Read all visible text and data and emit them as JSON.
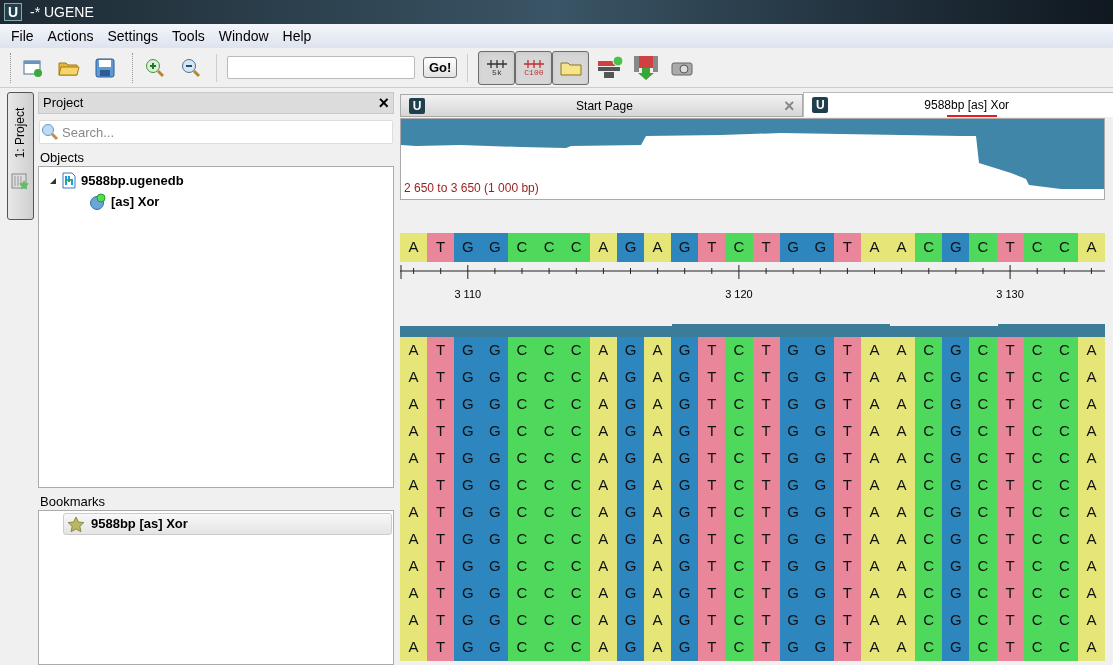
{
  "window": {
    "logo": "U",
    "title": "-* UGENE"
  },
  "menu": [
    "File",
    "Actions",
    "Settings",
    "Tools",
    "Window",
    "Help"
  ],
  "toolbar": {
    "go_button": "Go!",
    "toggles": [
      {
        "kind": "ruler",
        "label": "5k",
        "checked": true
      },
      {
        "kind": "ruler-red",
        "label": "C100",
        "checked": true
      },
      {
        "kind": "folder",
        "checked": true
      }
    ]
  },
  "side_tab": {
    "label": "1: Project"
  },
  "project_panel": {
    "title": "Project",
    "close": "×",
    "search": {
      "placeholder": "Search..."
    },
    "objects_label": "Objects",
    "tree": [
      {
        "label": "9588bp.ugenedb",
        "kind": "database",
        "expanded": true,
        "children": [
          {
            "label": "[as] Xor",
            "kind": "alignment"
          }
        ]
      }
    ],
    "bookmarks_label": "Bookmarks",
    "bookmarks": [
      {
        "label": "9588bp [as] Xor"
      }
    ]
  },
  "tabs": [
    {
      "logo": "U",
      "label": "Start Page",
      "close": "×",
      "selected": false
    },
    {
      "logo": "U",
      "label": "9588bp [as] Xor",
      "selected": true
    }
  ],
  "overview": {
    "range": "2 650 to 3 650 (1 000 bp)"
  },
  "reference": [
    {
      "base": "A",
      "color": "#e6e678"
    },
    {
      "base": "T",
      "color": "#e9869a"
    },
    {
      "base": "G",
      "color": "#2e86bf"
    },
    {
      "base": "G",
      "color": "#2e86bf"
    },
    {
      "base": "C",
      "color": "#4ed85c"
    },
    {
      "base": "C",
      "color": "#4ed85c"
    },
    {
      "base": "C",
      "color": "#4ed85c"
    },
    {
      "base": "A",
      "color": "#e6e678"
    },
    {
      "base": "G",
      "color": "#2e86bf"
    },
    {
      "base": "A",
      "color": "#e6e678"
    },
    {
      "base": "G",
      "color": "#2e86bf"
    },
    {
      "base": "T",
      "color": "#e9869a"
    },
    {
      "base": "C",
      "color": "#4ed85c"
    },
    {
      "base": "T",
      "color": "#e9869a"
    },
    {
      "base": "G",
      "color": "#2e86bf"
    },
    {
      "base": "G",
      "color": "#2e86bf"
    },
    {
      "base": "T",
      "color": "#e9869a"
    },
    {
      "base": "A",
      "color": "#e6e678"
    },
    {
      "base": "A",
      "color": "#e6e678"
    },
    {
      "base": "C",
      "color": "#4ed85c"
    },
    {
      "base": "G",
      "color": "#2e86bf"
    },
    {
      "base": "C",
      "color": "#4ed85c"
    },
    {
      "base": "T",
      "color": "#e9869a"
    },
    {
      "base": "C",
      "color": "#4ed85c"
    },
    {
      "base": "C",
      "color": "#4ed85c"
    },
    {
      "base": "A",
      "color": "#e6e678"
    }
  ],
  "ruler": {
    "labels": [
      "3 110",
      "3 120",
      "3 130"
    ]
  },
  "reads": [
    {
      "bases": [
        {
          "base": "A",
          "color": "#e6e678"
        },
        {
          "base": "T",
          "color": "#e9869a"
        },
        {
          "base": "G",
          "color": "#2e86bf"
        },
        {
          "base": "G",
          "color": "#2e86bf"
        },
        {
          "base": "C",
          "color": "#4ed85c"
        },
        {
          "base": "C",
          "color": "#4ed85c"
        },
        {
          "base": "C",
          "color": "#4ed85c"
        },
        {
          "base": "A",
          "color": "#e6e678"
        },
        {
          "base": "G",
          "color": "#2e86bf"
        },
        {
          "base": "A",
          "color": "#e6e678"
        },
        {
          "base": "G",
          "color": "#2e86bf"
        },
        {
          "base": "T",
          "color": "#e9869a"
        },
        {
          "base": "C",
          "color": "#4ed85c"
        },
        {
          "base": "T",
          "color": "#e9869a"
        },
        {
          "base": "G",
          "color": "#2e86bf"
        },
        {
          "base": "G",
          "color": "#2e86bf"
        },
        {
          "base": "T",
          "color": "#e9869a"
        },
        {
          "base": "A",
          "color": "#e6e678"
        },
        {
          "base": "A",
          "color": "#e6e678"
        },
        {
          "base": "C",
          "color": "#4ed85c"
        },
        {
          "base": "G",
          "color": "#2e86bf"
        },
        {
          "base": "C",
          "color": "#4ed85c"
        },
        {
          "base": "T",
          "color": "#e9869a"
        },
        {
          "base": "C",
          "color": "#4ed85c"
        },
        {
          "base": "C",
          "color": "#4ed85c"
        },
        {
          "base": "A",
          "color": "#e6e678"
        }
      ]
    },
    {
      "bases": [
        {
          "base": "A",
          "color": "#e6e678"
        },
        {
          "base": "T",
          "color": "#e9869a"
        },
        {
          "base": "G",
          "color": "#2e86bf"
        },
        {
          "base": "G",
          "color": "#2e86bf"
        },
        {
          "base": "C",
          "color": "#4ed85c"
        },
        {
          "base": "C",
          "color": "#4ed85c"
        },
        {
          "base": "C",
          "color": "#4ed85c"
        },
        {
          "base": "A",
          "color": "#e6e678"
        },
        {
          "base": "G",
          "color": "#2e86bf"
        },
        {
          "base": "A",
          "color": "#e6e678"
        },
        {
          "base": "G",
          "color": "#2e86bf"
        },
        {
          "base": "T",
          "color": "#e9869a"
        },
        {
          "base": "C",
          "color": "#4ed85c"
        },
        {
          "base": "T",
          "color": "#e9869a"
        },
        {
          "base": "G",
          "color": "#2e86bf"
        },
        {
          "base": "G",
          "color": "#2e86bf"
        },
        {
          "base": "T",
          "color": "#e9869a"
        },
        {
          "base": "A",
          "color": "#e6e678"
        },
        {
          "base": "A",
          "color": "#e6e678"
        },
        {
          "base": "C",
          "color": "#4ed85c"
        },
        {
          "base": "G",
          "color": "#2e86bf"
        },
        {
          "base": "C",
          "color": "#4ed85c"
        },
        {
          "base": "T",
          "color": "#e9869a"
        },
        {
          "base": "C",
          "color": "#4ed85c"
        },
        {
          "base": "C",
          "color": "#4ed85c"
        },
        {
          "base": "A",
          "color": "#e6e678"
        }
      ]
    },
    {
      "bases": [
        {
          "base": "A",
          "color": "#e6e678"
        },
        {
          "base": "T",
          "color": "#e9869a"
        },
        {
          "base": "G",
          "color": "#2e86bf"
        },
        {
          "base": "G",
          "color": "#2e86bf"
        },
        {
          "base": "C",
          "color": "#4ed85c"
        },
        {
          "base": "C",
          "color": "#4ed85c"
        },
        {
          "base": "C",
          "color": "#4ed85c"
        },
        {
          "base": "A",
          "color": "#e6e678"
        },
        {
          "base": "G",
          "color": "#2e86bf"
        },
        {
          "base": "A",
          "color": "#e6e678"
        },
        {
          "base": "G",
          "color": "#2e86bf"
        },
        {
          "base": "T",
          "color": "#e9869a"
        },
        {
          "base": "C",
          "color": "#4ed85c"
        },
        {
          "base": "T",
          "color": "#e9869a"
        },
        {
          "base": "G",
          "color": "#2e86bf"
        },
        {
          "base": "G",
          "color": "#2e86bf"
        },
        {
          "base": "T",
          "color": "#e9869a"
        },
        {
          "base": "A",
          "color": "#e6e678"
        },
        {
          "base": "A",
          "color": "#e6e678"
        },
        {
          "base": "C",
          "color": "#4ed85c"
        },
        {
          "base": "G",
          "color": "#2e86bf"
        },
        {
          "base": "C",
          "color": "#4ed85c"
        },
        {
          "base": "T",
          "color": "#e9869a"
        },
        {
          "base": "C",
          "color": "#4ed85c"
        },
        {
          "base": "C",
          "color": "#4ed85c"
        },
        {
          "base": "A",
          "color": "#e6e678"
        }
      ]
    },
    {
      "bases": [
        {
          "base": "A",
          "color": "#e6e678"
        },
        {
          "base": "T",
          "color": "#e9869a"
        },
        {
          "base": "G",
          "color": "#2e86bf"
        },
        {
          "base": "G",
          "color": "#2e86bf"
        },
        {
          "base": "C",
          "color": "#4ed85c"
        },
        {
          "base": "C",
          "color": "#4ed85c"
        },
        {
          "base": "C",
          "color": "#4ed85c"
        },
        {
          "base": "A",
          "color": "#e6e678"
        },
        {
          "base": "G",
          "color": "#2e86bf"
        },
        {
          "base": "A",
          "color": "#e6e678"
        },
        {
          "base": "G",
          "color": "#2e86bf"
        },
        {
          "base": "T",
          "color": "#e9869a"
        },
        {
          "base": "C",
          "color": "#4ed85c"
        },
        {
          "base": "T",
          "color": "#e9869a"
        },
        {
          "base": "G",
          "color": "#2e86bf"
        },
        {
          "base": "G",
          "color": "#2e86bf"
        },
        {
          "base": "T",
          "color": "#e9869a"
        },
        {
          "base": "A",
          "color": "#e6e678"
        },
        {
          "base": "A",
          "color": "#e6e678"
        },
        {
          "base": "C",
          "color": "#4ed85c"
        },
        {
          "base": "G",
          "color": "#2e86bf"
        },
        {
          "base": "C",
          "color": "#4ed85c"
        },
        {
          "base": "T",
          "color": "#e9869a"
        },
        {
          "base": "C",
          "color": "#4ed85c"
        },
        {
          "base": "C",
          "color": "#4ed85c"
        },
        {
          "base": "A",
          "color": "#e6e678"
        }
      ]
    },
    {
      "bases": [
        {
          "base": "A",
          "color": "#e6e678"
        },
        {
          "base": "T",
          "color": "#e9869a"
        },
        {
          "base": "G",
          "color": "#2e86bf"
        },
        {
          "base": "G",
          "color": "#2e86bf"
        },
        {
          "base": "C",
          "color": "#4ed85c"
        },
        {
          "base": "C",
          "color": "#4ed85c"
        },
        {
          "base": "C",
          "color": "#4ed85c"
        },
        {
          "base": "A",
          "color": "#e6e678"
        },
        {
          "base": "G",
          "color": "#2e86bf"
        },
        {
          "base": "A",
          "color": "#e6e678"
        },
        {
          "base": "G",
          "color": "#2e86bf"
        },
        {
          "base": "T",
          "color": "#e9869a"
        },
        {
          "base": "C",
          "color": "#4ed85c"
        },
        {
          "base": "T",
          "color": "#e9869a"
        },
        {
          "base": "G",
          "color": "#2e86bf"
        },
        {
          "base": "G",
          "color": "#2e86bf"
        },
        {
          "base": "T",
          "color": "#e9869a"
        },
        {
          "base": "A",
          "color": "#e6e678"
        },
        {
          "base": "A",
          "color": "#e6e678"
        },
        {
          "base": "C",
          "color": "#4ed85c"
        },
        {
          "base": "G",
          "color": "#2e86bf"
        },
        {
          "base": "C",
          "color": "#4ed85c"
        },
        {
          "base": "T",
          "color": "#e9869a"
        },
        {
          "base": "C",
          "color": "#4ed85c"
        },
        {
          "base": "C",
          "color": "#4ed85c"
        },
        {
          "base": "A",
          "color": "#e6e678"
        }
      ]
    },
    {
      "bases": [
        {
          "base": "A",
          "color": "#e6e678"
        },
        {
          "base": "T",
          "color": "#e9869a"
        },
        {
          "base": "G",
          "color": "#2e86bf"
        },
        {
          "base": "G",
          "color": "#2e86bf"
        },
        {
          "base": "C",
          "color": "#4ed85c"
        },
        {
          "base": "C",
          "color": "#4ed85c"
        },
        {
          "base": "C",
          "color": "#4ed85c"
        },
        {
          "base": "A",
          "color": "#e6e678"
        },
        {
          "base": "G",
          "color": "#2e86bf"
        },
        {
          "base": "A",
          "color": "#e6e678"
        },
        {
          "base": "G",
          "color": "#2e86bf"
        },
        {
          "base": "T",
          "color": "#e9869a"
        },
        {
          "base": "C",
          "color": "#4ed85c"
        },
        {
          "base": "T",
          "color": "#e9869a"
        },
        {
          "base": "G",
          "color": "#2e86bf"
        },
        {
          "base": "G",
          "color": "#2e86bf"
        },
        {
          "base": "T",
          "color": "#e9869a"
        },
        {
          "base": "A",
          "color": "#e6e678"
        },
        {
          "base": "A",
          "color": "#e6e678"
        },
        {
          "base": "C",
          "color": "#4ed85c"
        },
        {
          "base": "G",
          "color": "#2e86bf"
        },
        {
          "base": "C",
          "color": "#4ed85c"
        },
        {
          "base": "T",
          "color": "#e9869a"
        },
        {
          "base": "C",
          "color": "#4ed85c"
        },
        {
          "base": "C",
          "color": "#4ed85c"
        },
        {
          "base": "A",
          "color": "#e6e678"
        }
      ]
    },
    {
      "bases": [
        {
          "base": "A",
          "color": "#e6e678"
        },
        {
          "base": "T",
          "color": "#e9869a"
        },
        {
          "base": "G",
          "color": "#2e86bf"
        },
        {
          "base": "G",
          "color": "#2e86bf"
        },
        {
          "base": "C",
          "color": "#4ed85c"
        },
        {
          "base": "C",
          "color": "#4ed85c"
        },
        {
          "base": "C",
          "color": "#4ed85c"
        },
        {
          "base": "A",
          "color": "#e6e678"
        },
        {
          "base": "G",
          "color": "#2e86bf"
        },
        {
          "base": "A",
          "color": "#e6e678"
        },
        {
          "base": "G",
          "color": "#2e86bf"
        },
        {
          "base": "T",
          "color": "#e9869a"
        },
        {
          "base": "C",
          "color": "#4ed85c"
        },
        {
          "base": "T",
          "color": "#e9869a"
        },
        {
          "base": "G",
          "color": "#2e86bf"
        },
        {
          "base": "G",
          "color": "#2e86bf"
        },
        {
          "base": "T",
          "color": "#e9869a"
        },
        {
          "base": "A",
          "color": "#e6e678"
        },
        {
          "base": "A",
          "color": "#e6e678"
        },
        {
          "base": "C",
          "color": "#4ed85c"
        },
        {
          "base": "G",
          "color": "#2e86bf"
        },
        {
          "base": "C",
          "color": "#4ed85c"
        },
        {
          "base": "T",
          "color": "#e9869a"
        },
        {
          "base": "C",
          "color": "#4ed85c"
        },
        {
          "base": "C",
          "color": "#4ed85c"
        },
        {
          "base": "A",
          "color": "#e6e678"
        }
      ]
    },
    {
      "bases": [
        {
          "base": "A",
          "color": "#e6e678"
        },
        {
          "base": "T",
          "color": "#e9869a"
        },
        {
          "base": "G",
          "color": "#2e86bf"
        },
        {
          "base": "G",
          "color": "#2e86bf"
        },
        {
          "base": "C",
          "color": "#4ed85c"
        },
        {
          "base": "C",
          "color": "#4ed85c"
        },
        {
          "base": "C",
          "color": "#4ed85c"
        },
        {
          "base": "A",
          "color": "#e6e678"
        },
        {
          "base": "G",
          "color": "#2e86bf"
        },
        {
          "base": "A",
          "color": "#e6e678"
        },
        {
          "base": "G",
          "color": "#2e86bf"
        },
        {
          "base": "T",
          "color": "#e9869a"
        },
        {
          "base": "C",
          "color": "#4ed85c"
        },
        {
          "base": "T",
          "color": "#e9869a"
        },
        {
          "base": "G",
          "color": "#2e86bf"
        },
        {
          "base": "G",
          "color": "#2e86bf"
        },
        {
          "base": "T",
          "color": "#e9869a"
        },
        {
          "base": "A",
          "color": "#e6e678"
        },
        {
          "base": "A",
          "color": "#e6e678"
        },
        {
          "base": "C",
          "color": "#4ed85c"
        },
        {
          "base": "G",
          "color": "#2e86bf"
        },
        {
          "base": "C",
          "color": "#4ed85c"
        },
        {
          "base": "T",
          "color": "#e9869a"
        },
        {
          "base": "C",
          "color": "#4ed85c"
        },
        {
          "base": "C",
          "color": "#4ed85c"
        },
        {
          "base": "A",
          "color": "#e6e678"
        }
      ]
    },
    {
      "bases": [
        {
          "base": "A",
          "color": "#e6e678"
        },
        {
          "base": "T",
          "color": "#e9869a"
        },
        {
          "base": "G",
          "color": "#2e86bf"
        },
        {
          "base": "G",
          "color": "#2e86bf"
        },
        {
          "base": "C",
          "color": "#4ed85c"
        },
        {
          "base": "C",
          "color": "#4ed85c"
        },
        {
          "base": "C",
          "color": "#4ed85c"
        },
        {
          "base": "A",
          "color": "#e6e678"
        },
        {
          "base": "G",
          "color": "#2e86bf"
        },
        {
          "base": "A",
          "color": "#e6e678"
        },
        {
          "base": "G",
          "color": "#2e86bf"
        },
        {
          "base": "T",
          "color": "#e9869a"
        },
        {
          "base": "C",
          "color": "#4ed85c"
        },
        {
          "base": "T",
          "color": "#e9869a"
        },
        {
          "base": "G",
          "color": "#2e86bf"
        },
        {
          "base": "G",
          "color": "#2e86bf"
        },
        {
          "base": "T",
          "color": "#e9869a"
        },
        {
          "base": "A",
          "color": "#e6e678"
        },
        {
          "base": "A",
          "color": "#e6e678"
        },
        {
          "base": "C",
          "color": "#4ed85c"
        },
        {
          "base": "G",
          "color": "#2e86bf"
        },
        {
          "base": "C",
          "color": "#4ed85c"
        },
        {
          "base": "T",
          "color": "#e9869a"
        },
        {
          "base": "C",
          "color": "#4ed85c"
        },
        {
          "base": "C",
          "color": "#4ed85c"
        },
        {
          "base": "A",
          "color": "#e6e678"
        }
      ]
    },
    {
      "bases": [
        {
          "base": "A",
          "color": "#e6e678"
        },
        {
          "base": "T",
          "color": "#e9869a"
        },
        {
          "base": "G",
          "color": "#2e86bf"
        },
        {
          "base": "G",
          "color": "#2e86bf"
        },
        {
          "base": "C",
          "color": "#4ed85c"
        },
        {
          "base": "C",
          "color": "#4ed85c"
        },
        {
          "base": "C",
          "color": "#4ed85c"
        },
        {
          "base": "A",
          "color": "#e6e678"
        },
        {
          "base": "G",
          "color": "#2e86bf"
        },
        {
          "base": "A",
          "color": "#e6e678"
        },
        {
          "base": "G",
          "color": "#2e86bf"
        },
        {
          "base": "T",
          "color": "#e9869a"
        },
        {
          "base": "C",
          "color": "#4ed85c"
        },
        {
          "base": "T",
          "color": "#e9869a"
        },
        {
          "base": "G",
          "color": "#2e86bf"
        },
        {
          "base": "G",
          "color": "#2e86bf"
        },
        {
          "base": "T",
          "color": "#e9869a"
        },
        {
          "base": "A",
          "color": "#e6e678"
        },
        {
          "base": "A",
          "color": "#e6e678"
        },
        {
          "base": "C",
          "color": "#4ed85c"
        },
        {
          "base": "G",
          "color": "#2e86bf"
        },
        {
          "base": "C",
          "color": "#4ed85c"
        },
        {
          "base": "T",
          "color": "#e9869a"
        },
        {
          "base": "C",
          "color": "#4ed85c"
        },
        {
          "base": "C",
          "color": "#4ed85c"
        },
        {
          "base": "A",
          "color": "#e6e678"
        }
      ]
    },
    {
      "bases": [
        {
          "base": "A",
          "color": "#e6e678"
        },
        {
          "base": "T",
          "color": "#e9869a"
        },
        {
          "base": "G",
          "color": "#2e86bf"
        },
        {
          "base": "G",
          "color": "#2e86bf"
        },
        {
          "base": "C",
          "color": "#4ed85c"
        },
        {
          "base": "C",
          "color": "#4ed85c"
        },
        {
          "base": "C",
          "color": "#4ed85c"
        },
        {
          "base": "A",
          "color": "#e6e678"
        },
        {
          "base": "G",
          "color": "#2e86bf"
        },
        {
          "base": "A",
          "color": "#e6e678"
        },
        {
          "base": "G",
          "color": "#2e86bf"
        },
        {
          "base": "T",
          "color": "#e9869a"
        },
        {
          "base": "C",
          "color": "#4ed85c"
        },
        {
          "base": "T",
          "color": "#e9869a"
        },
        {
          "base": "G",
          "color": "#2e86bf"
        },
        {
          "base": "G",
          "color": "#2e86bf"
        },
        {
          "base": "T",
          "color": "#e9869a"
        },
        {
          "base": "A",
          "color": "#e6e678"
        },
        {
          "base": "A",
          "color": "#e6e678"
        },
        {
          "base": "C",
          "color": "#4ed85c"
        },
        {
          "base": "G",
          "color": "#2e86bf"
        },
        {
          "base": "C",
          "color": "#4ed85c"
        },
        {
          "base": "T",
          "color": "#e9869a"
        },
        {
          "base": "C",
          "color": "#4ed85c"
        },
        {
          "base": "C",
          "color": "#4ed85c"
        },
        {
          "base": "A",
          "color": "#e6e678"
        }
      ]
    },
    {
      "bases": [
        {
          "base": "A",
          "color": "#e6e678"
        },
        {
          "base": "T",
          "color": "#e9869a"
        },
        {
          "base": "G",
          "color": "#2e86bf"
        },
        {
          "base": "G",
          "color": "#2e86bf"
        },
        {
          "base": "C",
          "color": "#4ed85c"
        },
        {
          "base": "C",
          "color": "#4ed85c"
        },
        {
          "base": "C",
          "color": "#4ed85c"
        },
        {
          "base": "A",
          "color": "#e6e678"
        },
        {
          "base": "G",
          "color": "#2e86bf"
        },
        {
          "base": "A",
          "color": "#e6e678"
        },
        {
          "base": "G",
          "color": "#2e86bf"
        },
        {
          "base": "T",
          "color": "#e9869a"
        },
        {
          "base": "C",
          "color": "#4ed85c"
        },
        {
          "base": "T",
          "color": "#e9869a"
        },
        {
          "base": "G",
          "color": "#2e86bf"
        },
        {
          "base": "G",
          "color": "#2e86bf"
        },
        {
          "base": "T",
          "color": "#e9869a"
        },
        {
          "base": "A",
          "color": "#e6e678"
        },
        {
          "base": "A",
          "color": "#e6e678"
        },
        {
          "base": "C",
          "color": "#4ed85c"
        },
        {
          "base": "G",
          "color": "#2e86bf"
        },
        {
          "base": "C",
          "color": "#4ed85c"
        },
        {
          "base": "T",
          "color": "#e9869a"
        },
        {
          "base": "C",
          "color": "#4ed85c"
        },
        {
          "base": "C",
          "color": "#4ed85c"
        },
        {
          "base": "A",
          "color": "#e6e678"
        }
      ]
    }
  ]
}
